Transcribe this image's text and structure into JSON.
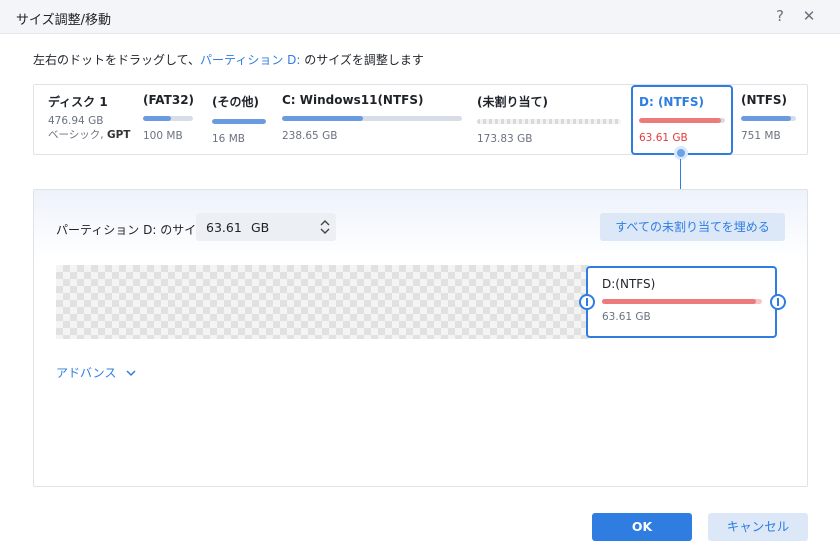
{
  "window": {
    "title": "サイズ調整/移動",
    "help_icon": "?",
    "close_icon": "✕"
  },
  "instruction": {
    "prefix": "左右のドットをドラッグして、",
    "highlight": "パーティション D:",
    "suffix": " のサイズを調整します"
  },
  "disk": {
    "name": "ディスク 1",
    "capacity": "476.94 GB",
    "type_prefix": "ベーシック, ",
    "type_bold": "GPT"
  },
  "partitions": [
    {
      "name": "(FAT32)",
      "size": "100 MB",
      "used_fraction": 0.55
    },
    {
      "name": "(その他)",
      "size": "16 MB",
      "used_fraction": 1.0
    },
    {
      "name": "C: Windows11(NTFS)",
      "size": "238.65 GB",
      "used_fraction": 0.45
    },
    {
      "name": "(未割り当て)",
      "size": "173.83 GB",
      "used_fraction": 0
    },
    {
      "name": "D: (NTFS)",
      "size": "63.61 GB",
      "used_fraction": 0.95
    },
    {
      "name": "(NTFS)",
      "size": "751 MB",
      "used_fraction": 0.9
    }
  ],
  "resize": {
    "size_label": "パーティション D: のサイズ",
    "size_value": "63.61",
    "size_unit": "GB",
    "fill_unallocated_label": "すべての未割り当てを埋める",
    "target_name": "D:(NTFS)",
    "target_size": "63.61 GB",
    "target_used_fraction": 0.96
  },
  "advanced": {
    "label": "アドバンス",
    "chevron": "⌄"
  },
  "footer": {
    "ok_label": "OK",
    "cancel_label": "キャンセル"
  },
  "colors": {
    "accent": "#2f7de1",
    "used_bar": "#6a9be0",
    "selected_bar": "#ee7b7b",
    "selected_size": "#e23b3b"
  }
}
